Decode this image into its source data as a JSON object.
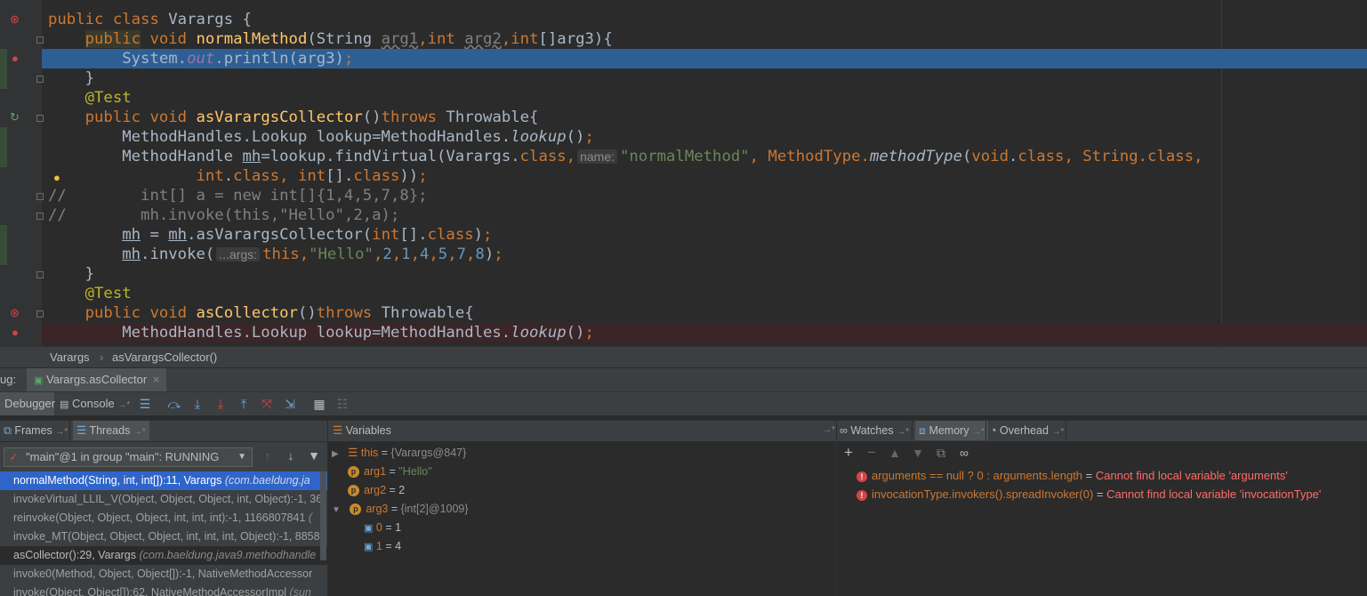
{
  "editor": {
    "lines": {
      "l1_a": "public ",
      "l1_b": "class ",
      "l1_c": "Varargs {",
      "l2_kw1": "public",
      "l2_kw2": " void ",
      "l2_fn": "normalMethod",
      "l2_p1": "(String ",
      "l2_arg1": "arg1",
      "l2_p2": ",",
      "l2_kw3": "int ",
      "l2_arg2": "arg2",
      "l2_p3": ",",
      "l2_kw4": "int",
      "l2_p4": "[]arg3){",
      "l3_a": "System.",
      "l3_b": "out",
      "l3_c": ".println(arg3)",
      "l3_d": ";",
      "l4": "}",
      "l5": "@Test",
      "l6_kw1": "public void ",
      "l6_fn": "asVarargsCollector",
      "l6_p1": "()",
      "l6_kw2": "throws ",
      "l6_p2": "Throwable{",
      "l7_a": "MethodHandles.Lookup lookup=MethodHandles.",
      "l7_b": "lookup",
      "l7_c": "()",
      "l7_d": ";",
      "l8_a": "MethodHandle ",
      "l8_b": "mh",
      "l8_c": "=lookup.findVirtual(Varargs.",
      "l8_d": "class",
      "l8_e": ",",
      "l8_hint": "name:",
      "l8_f": "\"normalMethod\"",
      "l8_g": ", MethodType.",
      "l8_h": "methodType",
      "l8_i": "(",
      "l8_j": "void",
      "l8_k": ".",
      "l8_l": "class",
      "l8_m": ", String.",
      "l8_n": "class",
      "l8_o": ",",
      "l9_a": "int",
      "l9_b": ".",
      "l9_c": "class",
      "l9_d": ", ",
      "l9_e": "int",
      "l9_f": "[].",
      "l9_g": "class",
      "l9_h": "))",
      "l9_i": ";",
      "l10": "//        int[] a = new int[]{1,4,5,7,8};",
      "l11": "//        mh.invoke(this,\"Hello\",2,a);",
      "l12_a": "mh",
      "l12_b": " = ",
      "l12_c": "mh",
      "l12_d": ".asVarargsCollector(",
      "l12_e": "int",
      "l12_f": "[].",
      "l12_g": "class",
      "l12_h": ")",
      "l12_i": ";",
      "l13_a": "mh",
      "l13_b": ".invoke(",
      "l13_hint": "...args:",
      "l13_c": "this",
      "l13_d": ",",
      "l13_e": "\"Hello\"",
      "l13_f": ",",
      "l13_g": "2",
      "l13_h": ",",
      "l13_i": "1",
      "l13_j": ",",
      "l13_k": "4",
      "l13_l": ",",
      "l13_m": "5",
      "l13_n": ",",
      "l13_o": "7",
      "l13_p": ",",
      "l13_q": "8",
      "l13_r": ")",
      "l13_s": ";",
      "l14": "}",
      "l15": "@Test",
      "l16_kw1": "public void ",
      "l16_fn": "asCollector",
      "l16_p1": "()",
      "l16_kw2": "throws ",
      "l16_p2": "Throwable{",
      "l17_a": "MethodHandles.Lookup lookup=MethodHandles.",
      "l17_b": "lookup",
      "l17_c": "()",
      "l17_d": ";"
    }
  },
  "breadcrumb": {
    "class": "Varargs",
    "sep": "›",
    "method": "asVarargsCollector()"
  },
  "debug": {
    "label": "ug:",
    "tab_title": "Varargs.asCollector",
    "tab_close": "×",
    "debugger_tab": "Debugger",
    "console_tab": "Console",
    "pin": "→*"
  },
  "panels": {
    "frames": "Frames",
    "threads": "Threads",
    "variables": "Variables",
    "watches": "Watches",
    "memory": "Memory",
    "overhead": "Overhead",
    "pin": "→*"
  },
  "thread_select": "\"main\"@1 in group \"main\": RUNNING",
  "frames_list": [
    {
      "sig": "normalMethod(String, int, int[]):11, Varargs ",
      "pkg": "(com.baeldung.ja"
    },
    {
      "sig": "invokeVirtual_LLIL_V(Object, Object, Object, int, Object):-1, 36",
      "pkg": ""
    },
    {
      "sig": "reinvoke(Object, Object, Object, int, int, int):-1, 1166807841 ",
      "pkg": "("
    },
    {
      "sig": "invoke_MT(Object, Object, Object, int, int, int, Object):-1, 8858",
      "pkg": ""
    },
    {
      "sig": "asCollector():29, Varargs ",
      "pkg": "(com.baeldung.java9.methodhandle"
    },
    {
      "sig": "invoke0(Method, Object, Object[]):-1, NativeMethodAccessor",
      "pkg": ""
    },
    {
      "sig": "invoke(Object, Object[]):62, NativeMethodAccessorImpl ",
      "pkg": "(sun"
    }
  ],
  "variables": {
    "this_name": "this",
    "this_val": "{Varargs@847}",
    "arg1_name": "arg1",
    "arg1_val": "\"Hello\"",
    "arg2_name": "arg2",
    "arg2_val": "2",
    "arg3_name": "arg3",
    "arg3_val": "{int[2]@1009}",
    "i0_name": "0",
    "i0_val": "1",
    "i1_name": "1",
    "i1_val": "4",
    "eq": " = ",
    "p_badge": "p"
  },
  "watches": [
    {
      "expr": "arguments == null ? 0 : arguments.length",
      "eq": " = ",
      "msg": "Cannot find local variable 'arguments'"
    },
    {
      "expr": "invocationType.invokers().spreadInvoker(0)",
      "eq": " = ",
      "msg": "Cannot find local variable 'invocationType'"
    }
  ],
  "colors": {
    "accent": "#2f65ca",
    "error": "#d14646",
    "highlight_line": "#2d5f95"
  }
}
